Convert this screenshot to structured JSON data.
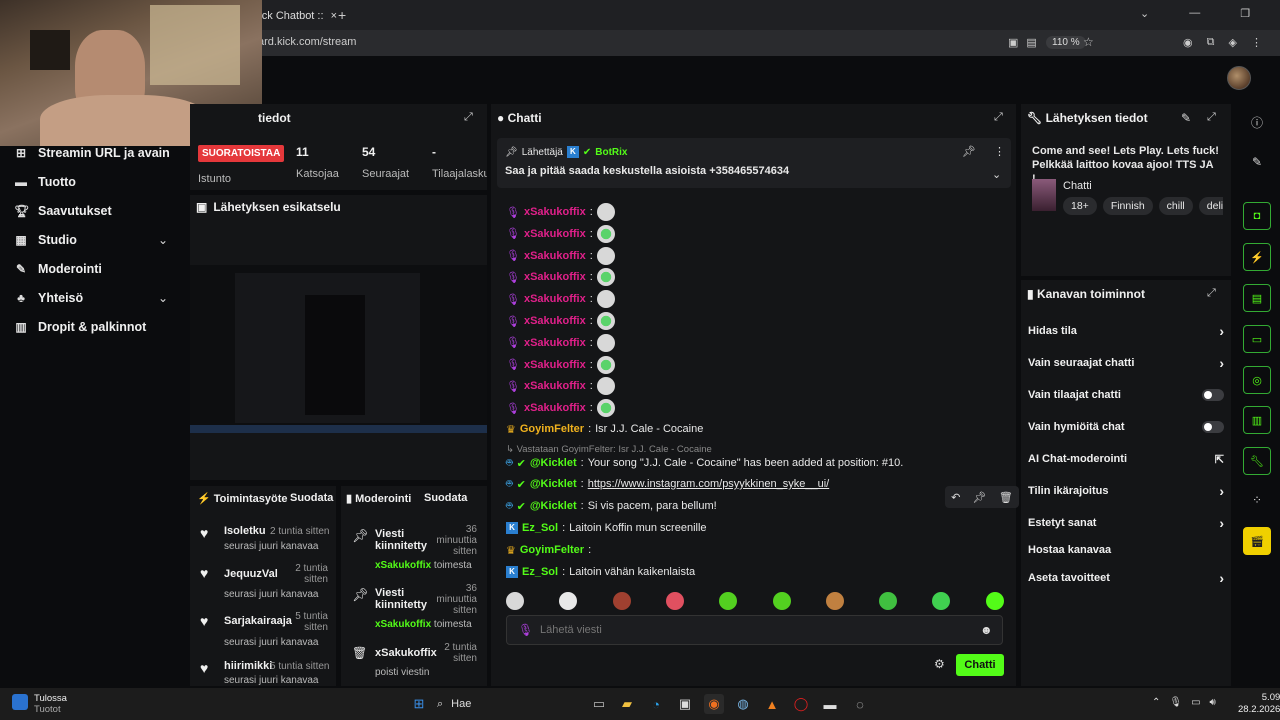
{
  "browser": {
    "tab_title": "Kick Chatbot ::",
    "url": "ard.kick.com/stream",
    "zoom": "110 %"
  },
  "sidebar": {
    "items": [
      {
        "label": "Streamin URL ja avain",
        "icon": "link-icon"
      },
      {
        "label": "Tuotto",
        "icon": "wallet-icon"
      },
      {
        "label": "Saavutukset",
        "icon": "trophy-icon"
      },
      {
        "label": "Studio",
        "icon": "studio-icon"
      },
      {
        "label": "Moderointi",
        "icon": "wrench-icon"
      },
      {
        "label": "Yhteisö",
        "icon": "community-icon"
      },
      {
        "label": "Dropit & palkinnot",
        "icon": "gift-icon"
      }
    ]
  },
  "stream_info": {
    "header": "tiedot",
    "live_badge": "SUORATOISTAA",
    "session_label": "Istunto",
    "viewers": "11",
    "viewers_label": "Katsojaa",
    "followers": "54",
    "followers_label": "Seuraajat",
    "subs": "-",
    "subs_label": "Tilaajalasku"
  },
  "preview": {
    "header": "Lähetyksen esikatselu"
  },
  "activity": {
    "header": "Toimintasyöte",
    "popout": "Suodata",
    "items": [
      {
        "name": "Isoletku",
        "time": "2 tuntia sitten",
        "desc": "seurasi juuri kanavaa"
      },
      {
        "name": "JequuzVal",
        "time": "2 tuntia sitten",
        "desc": "seurasi juuri kanavaa"
      },
      {
        "name": "Sarjakairaaja",
        "time": "5 tuntia sitten",
        "desc": "seurasi juuri kanavaa"
      },
      {
        "name": "hiirimikki",
        "time": "5 tuntia sitten",
        "desc": "seurasi juuri kanavaa"
      }
    ]
  },
  "moderation": {
    "header": "Moderointi",
    "popout": "Suodata",
    "items": [
      {
        "title": "Viesti kiinnitetty",
        "time": "36 minuuttia sitten",
        "user": "xSakukoffix",
        "action": "toimesta"
      },
      {
        "title": "Viesti kiinnitetty",
        "time": "36 minuuttia sitten",
        "user": "xSakukoffix",
        "action": "toimesta"
      },
      {
        "title": "xSakukoffix",
        "time": "2 tuntia sitten",
        "user": "",
        "action": "poisti viestin"
      }
    ]
  },
  "chat": {
    "header": "Chatti",
    "pinned_label": "Lähettäjä",
    "pinned_user": "BotRix",
    "pinned_text": "Saa ja pitää saada keskustella asioista +358465574634",
    "spam_user": "xSakukoffix",
    "messages": [
      {
        "user": "GoyimFelter",
        "text": "Isr J.J. Cale - Cocaine"
      },
      {
        "reply": "Vastataan GoyimFelter: Isr J.J. Cale - Cocaine"
      },
      {
        "user": "@Kicklet",
        "text": "Your song \"J.J. Cale - Cocaine\" has been added at position: #10."
      },
      {
        "user": "@Kicklet",
        "text": "https://www.instagram.com/psyykkinen_syke__ui/"
      },
      {
        "user": "@Kicklet",
        "text": "Si vis pacem, para bellum!"
      },
      {
        "user": "Ez_Sol",
        "text": "Laitoin Koffin mun screenille"
      },
      {
        "user": "GoyimFelter",
        "text": ""
      },
      {
        "user": "Ez_Sol",
        "text": "Laitoin vähän kaikenlaista"
      }
    ],
    "input_placeholder": "Lähetä viesti",
    "send_label": "Chatti"
  },
  "broadcast": {
    "header": "Lähetyksen tiedot",
    "title": "Come and see! Lets Play. Lets fuck! Pelkkää laittoo kovaa ajoo! TTS JA !...",
    "category": "Chatti",
    "tags": [
      "18+",
      "Finnish",
      "chill",
      "delirio"
    ]
  },
  "channel_actions": {
    "header": "Kanavan toiminnot",
    "items": [
      {
        "label": "Hidas tila",
        "control": "chevron"
      },
      {
        "label": "Vain seuraajat chatti",
        "control": "chevron"
      },
      {
        "label": "Vain tilaajat chatti",
        "control": "toggle"
      },
      {
        "label": "Vain hymiöitä chat",
        "control": "toggle"
      },
      {
        "label": "AI Chat-moderointi",
        "control": "external"
      },
      {
        "label": "Tilin ikärajoitus",
        "control": "chevron"
      },
      {
        "label": "Estetyt sanat",
        "control": "chevron"
      },
      {
        "label": "Hostaa kanavaa",
        "control": "none"
      },
      {
        "label": "Aseta tavoitteet",
        "control": "chevron"
      }
    ]
  },
  "taskbar": {
    "weather_title": "Tulossa",
    "weather_sub": "Tuotot",
    "search": "Hae",
    "time": "5.09",
    "date": "28.2.2026"
  },
  "colors": {
    "accent": "#53fc18",
    "live": "#e5383b",
    "pink_user": "#e0208a",
    "gold_user": "#f0b21e"
  }
}
